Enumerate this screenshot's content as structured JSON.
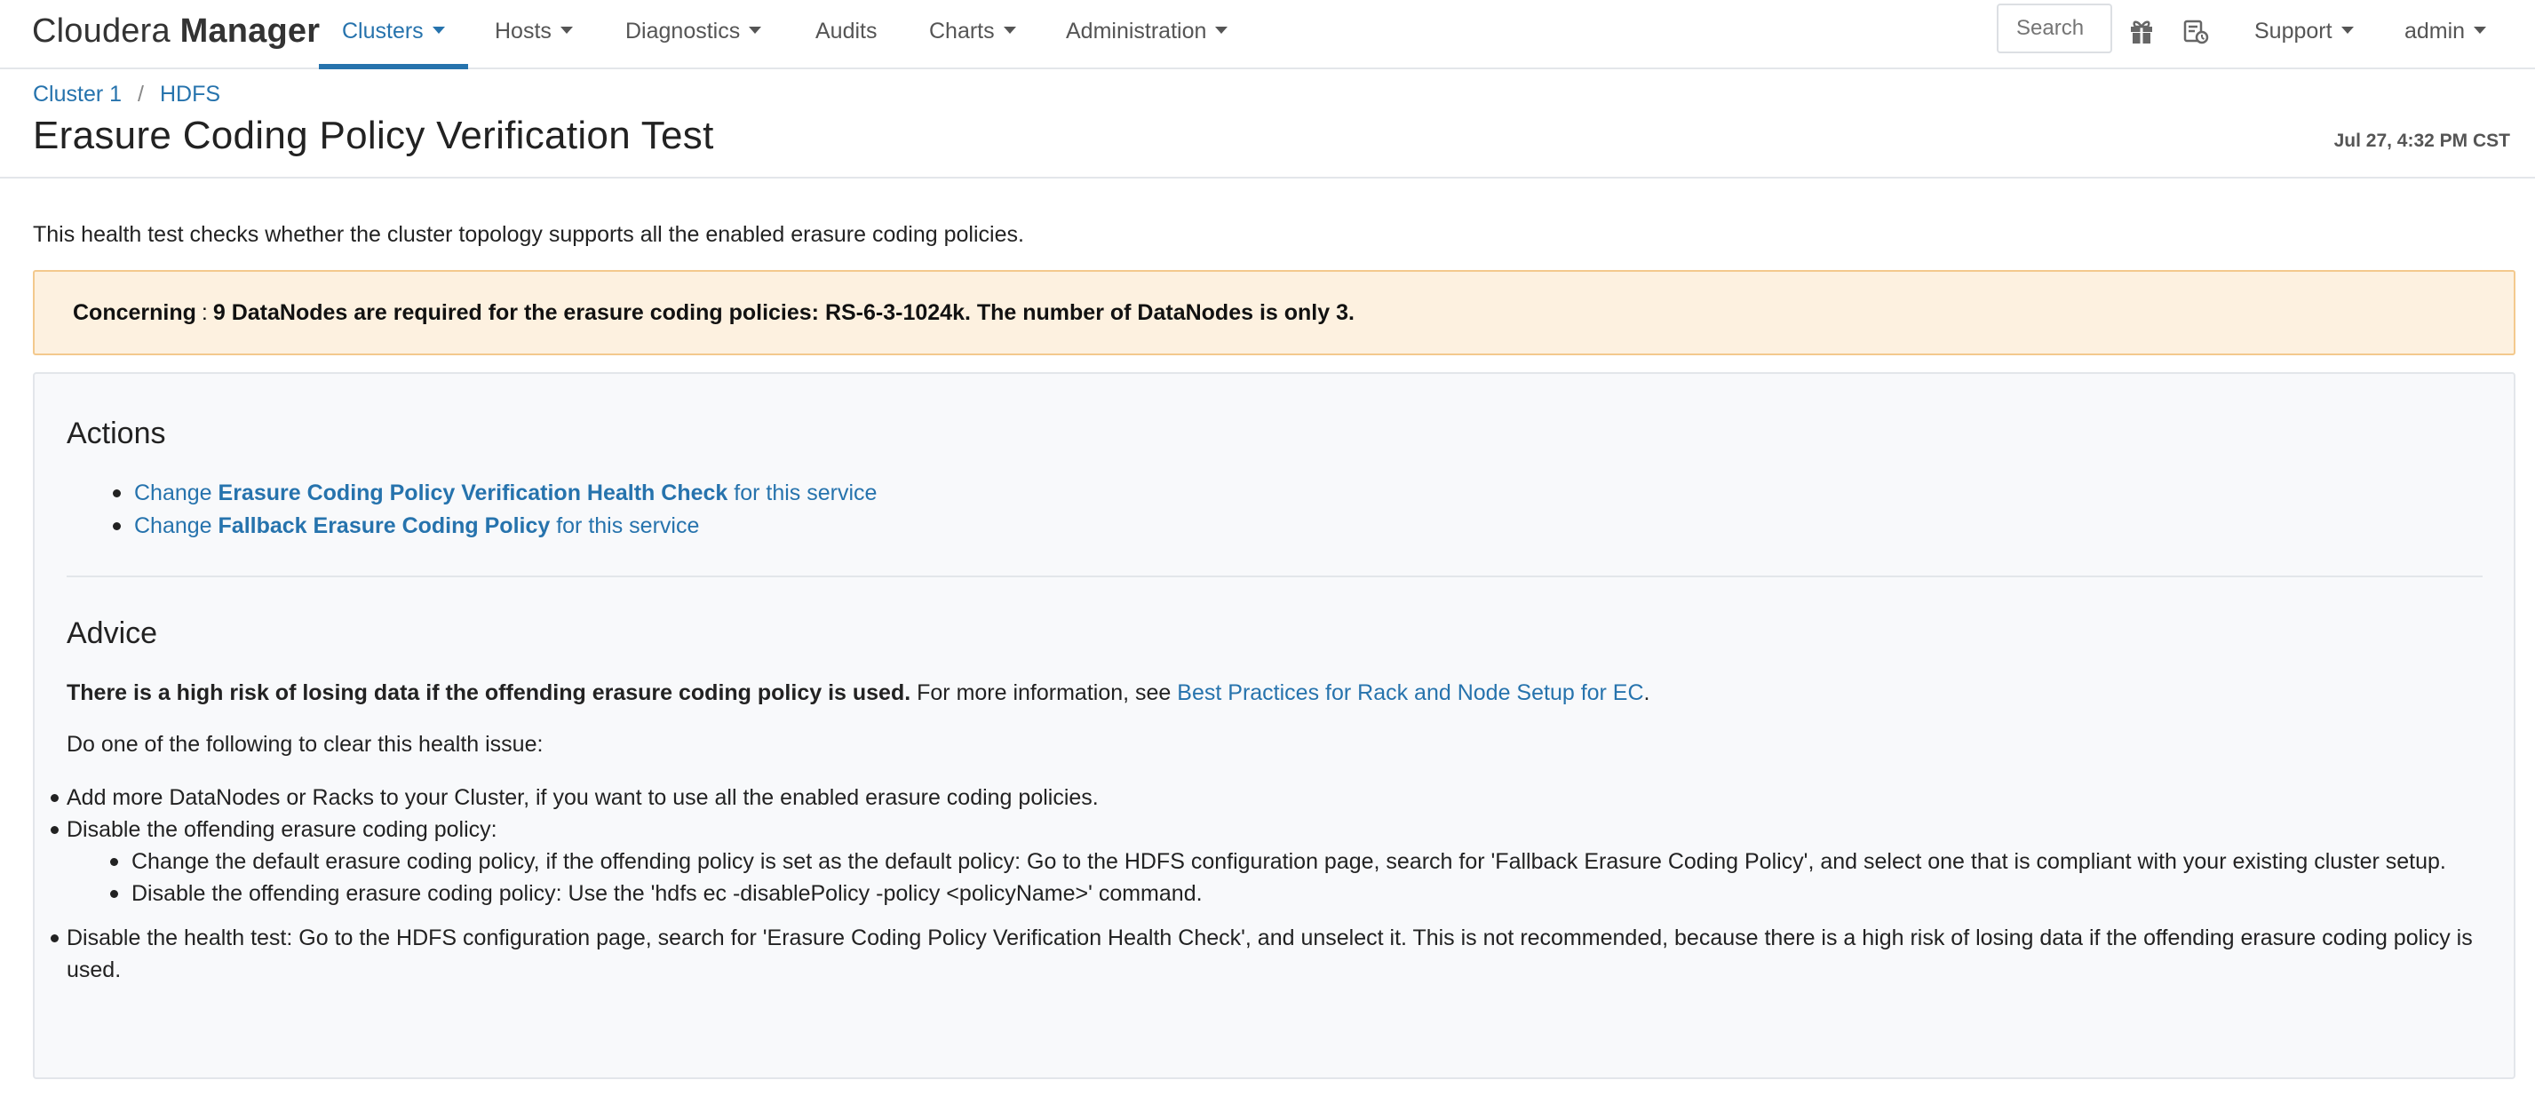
{
  "brand": {
    "light": "Cloudera",
    "bold": "Manager"
  },
  "nav": {
    "clusters": "Clusters",
    "hosts": "Hosts",
    "diagnostics": "Diagnostics",
    "audits": "Audits",
    "charts": "Charts",
    "administration": "Administration",
    "search_placeholder": "Search",
    "support": "Support",
    "user": "admin"
  },
  "colors": {
    "link": "#2673ad",
    "alert_bg": "#fdf1e0",
    "alert_border": "#f3c98d"
  },
  "icons": {
    "whats_new": "gift-icon",
    "running_commands": "commands-icon"
  },
  "breadcrumb": {
    "cluster": "Cluster 1",
    "separator": "/",
    "service": "HDFS"
  },
  "header": {
    "title": "Erasure Coding Policy Verification Test",
    "timestamp": "Jul 27, 4:32 PM CST"
  },
  "description": "This health test checks whether the cluster topology supports all the enabled erasure coding policies.",
  "alert": {
    "severity": "Concerning",
    "separator": ":",
    "message": "9 DataNodes are required for the erasure coding policies: RS-6-3-1024k. The number of DataNodes is only 3."
  },
  "actions": {
    "title": "Actions",
    "items": [
      {
        "prefix": "Change ",
        "bold": "Erasure Coding Policy Verification Health Check",
        "suffix": " for this service"
      },
      {
        "prefix": "Change ",
        "bold": "Fallback Erasure Coding Policy",
        "suffix": " for this service"
      }
    ]
  },
  "advice": {
    "title": "Advice",
    "risk_bold": "There is a high risk of losing data if the offending erasure coding policy is used.",
    "more_info": " For more information, see ",
    "link": "Best Practices for Rack and Node Setup for EC",
    "period": ".",
    "intro": "Do one of the following to clear this health issue:",
    "items": [
      "Add more DataNodes or Racks to your Cluster, if you want to use all the enabled erasure coding policies.",
      "Disable the offending erasure coding policy:",
      "Disable the health test: Go to the HDFS configuration page, search for 'Erasure Coding Policy Verification Health Check', and unselect it. This is not recommended, because there is a high risk of losing data if the offending erasure coding policy is used."
    ],
    "subitems": [
      "Change the default erasure coding policy, if the offending policy is set as the default policy: Go to the HDFS configuration page, search for 'Fallback Erasure Coding Policy', and select one that is compliant with your existing cluster setup.",
      "Disable the offending erasure coding policy: Use the 'hdfs ec -disablePolicy -policy <policyName>' command."
    ]
  }
}
